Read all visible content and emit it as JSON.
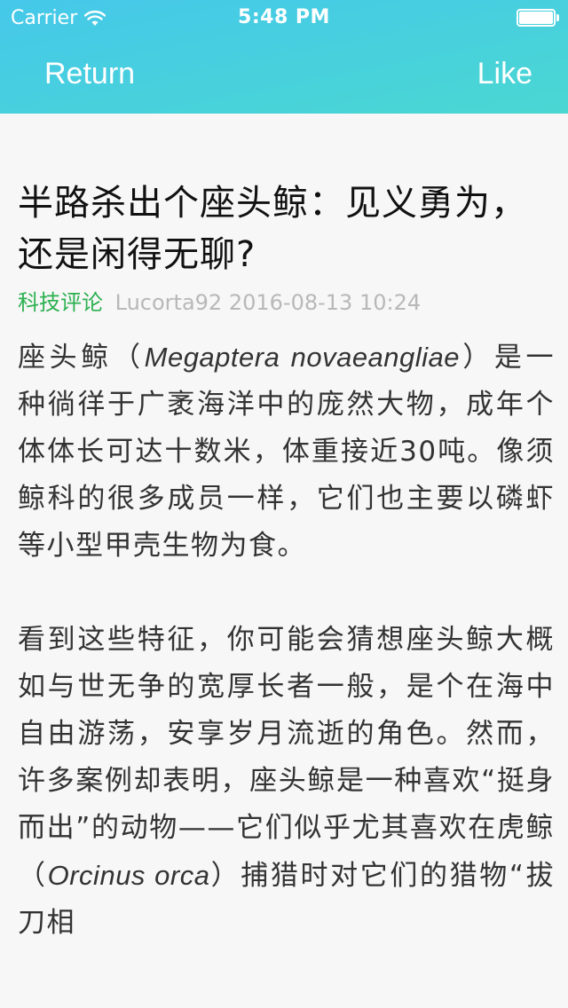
{
  "status_bar": {
    "carrier": "Carrier",
    "time": "5:48 PM"
  },
  "nav": {
    "return_label": "Return",
    "like_label": "Like"
  },
  "article": {
    "title": "半路杀出个座头鲸：见义勇为，还是闲得无聊?",
    "category": "科技评论",
    "author": "Lucorta92",
    "datetime": "2016-08-13 10:24",
    "p1_a": "座头鲸（",
    "p1_latin": "Megaptera novaeangliae",
    "p1_b": "）是一种徜徉于广袤海洋中的庞然大物，成年个体体长可达十数米，体重接近30吨。像须鲸科的很多成员一样，它们也主要以磷虾等小型甲壳生物为食。",
    "p2_a": "看到这些特征，你可能会猜想座头鲸大概如与世无争的宽厚长者一般，是个在海中自由游荡，安享岁月流逝的角色。然而，许多案例却表明，座头鲸是一种喜欢“挺身而出”的动物——它们似乎尤其喜欢在虎鲸（",
    "p2_latin": "Orcinus orca",
    "p2_b": "）捕猎时对它们的猎物“拔刀相"
  },
  "colors": {
    "header_start": "#45c8ea",
    "header_end": "#4ad7d2",
    "category": "#2bb04f",
    "meta": "#b8b8b8",
    "background": "#f7f7f7"
  }
}
